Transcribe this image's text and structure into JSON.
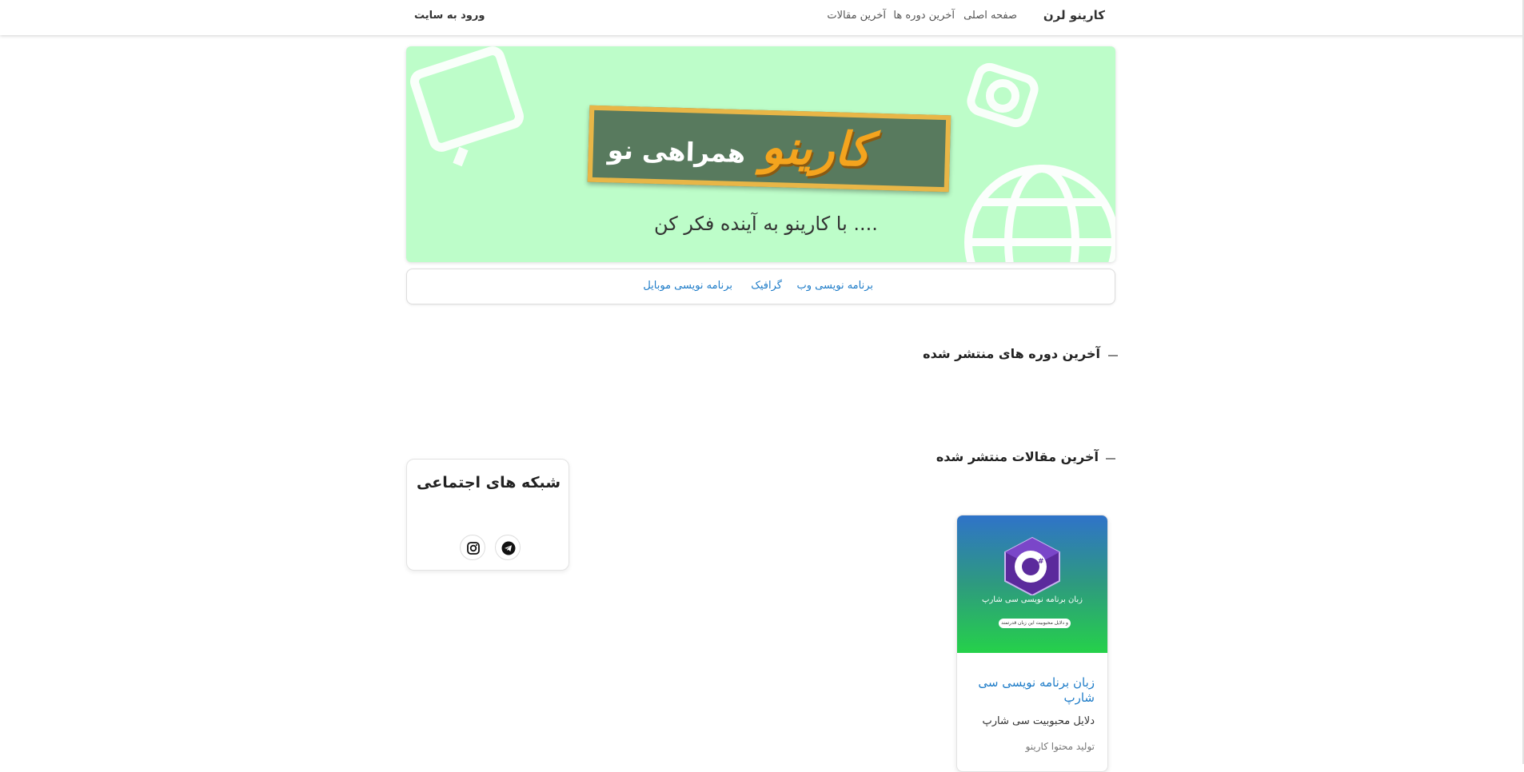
{
  "navbar": {
    "brand": "کارینو لرن",
    "links": [
      "صفحه اصلی",
      "آخرین دوره ها",
      "آخرین مقالات"
    ],
    "login": "ورود به سایت"
  },
  "banner": {
    "logo_text": "کارینو",
    "board_subtitle": "همراهی نو",
    "slogan": "با کارینو به آینده فکر کن ...."
  },
  "categories": [
    "برنامه نویسی وب",
    "گرافیک",
    "برنامه نویسی موبایل"
  ],
  "sections": {
    "courses_title": "آخرین دوره های منتشر شده",
    "articles_title": "آخرین مقالات منتشر شده"
  },
  "social": {
    "title": "شبکه های اجتماعی",
    "icons": [
      "telegram-icon",
      "instagram-icon"
    ]
  },
  "article_card": {
    "image_text": "زبان برنامه نویسی سی شارپ",
    "image_pill": "و دلایل محبوبیت این زبان قدرتمند",
    "title": "زبان برنامه نویسی سی شارپ",
    "description": "دلایل محبوبیت سی شارپ",
    "author": "تولید محتوا کارینو"
  },
  "colors": {
    "link": "#1e7cc8",
    "banner_bg": "#bdfdc9",
    "logo_orange": "#f4a41e",
    "board_green": "#587a5e"
  }
}
